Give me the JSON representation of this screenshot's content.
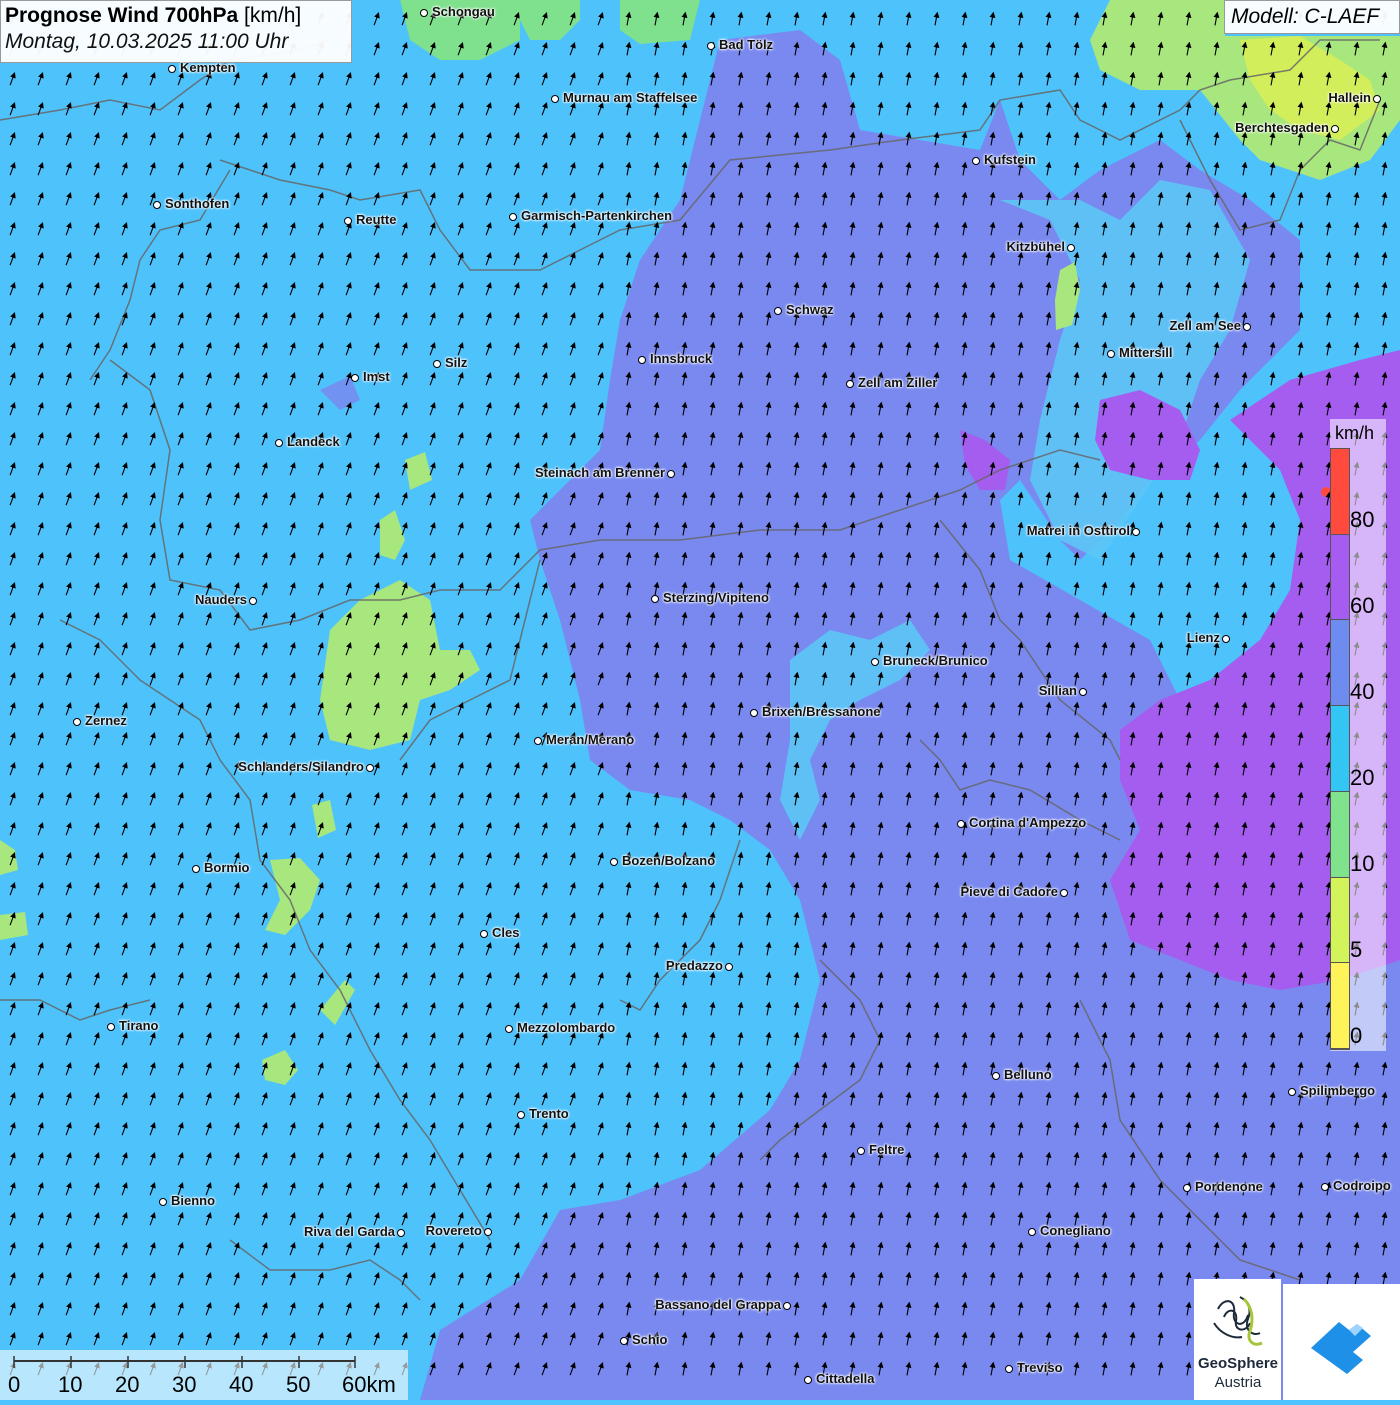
{
  "header": {
    "title_bold": "Prognose Wind 700hPa",
    "title_unit": " [km/h]",
    "datetime": "Montag, 10.03.2025 11:00 Uhr",
    "model": "Modell: C-LAEF"
  },
  "legend": {
    "unit": "km/h",
    "labels": [
      "80",
      "60",
      "40",
      "20",
      "10",
      "5",
      "0"
    ],
    "colors": [
      "#ff4a3d",
      "#a65cf0",
      "#6e8cf0",
      "#33c6f5",
      "#7ee38c",
      "#d2f35a",
      "#fff35a"
    ]
  },
  "scale": {
    "labels": [
      "0",
      "10",
      "20",
      "30",
      "40",
      "50",
      "60km"
    ]
  },
  "branding": {
    "name": "GeoSphere",
    "sub": "Austria"
  },
  "cities": [
    {
      "name": "Schongau"
    },
    {
      "name": "Bad Tölz"
    },
    {
      "name": "Kempten"
    },
    {
      "name": "Murnau am Staffelsee"
    },
    {
      "name": "Hallein"
    },
    {
      "name": "Berchtesgaden"
    },
    {
      "name": "Kufstein"
    },
    {
      "name": "Sonthofen"
    },
    {
      "name": "Reutte"
    },
    {
      "name": "Garmisch-Partenkirchen"
    },
    {
      "name": "Kitzbühel"
    },
    {
      "name": "Schwaz"
    },
    {
      "name": "Zell am See"
    },
    {
      "name": "Mittersill"
    },
    {
      "name": "Innsbruck"
    },
    {
      "name": "Imst"
    },
    {
      "name": "Silz"
    },
    {
      "name": "Zell am Ziller"
    },
    {
      "name": "Landeck"
    },
    {
      "name": "Steinach am Brenner"
    },
    {
      "name": "Matrei in Osttirol"
    },
    {
      "name": "Nauders"
    },
    {
      "name": "Sterzing/Vipiteno"
    },
    {
      "name": "Lienz"
    },
    {
      "name": "Bruneck/Brunico"
    },
    {
      "name": "Sillian"
    },
    {
      "name": "Brixen/Bressanone"
    },
    {
      "name": "Zernez"
    },
    {
      "name": "Meran/Merano"
    },
    {
      "name": "Schlanders/Silandro"
    },
    {
      "name": "Cortina d'Ampezzo"
    },
    {
      "name": "Bozen/Bolzano"
    },
    {
      "name": "Bormio"
    },
    {
      "name": "Pieve di Cadore"
    },
    {
      "name": "Cles"
    },
    {
      "name": "Predazzo"
    },
    {
      "name": "Tirano"
    },
    {
      "name": "Mezzolombardo"
    },
    {
      "name": "Belluno"
    },
    {
      "name": "Spilimbergo"
    },
    {
      "name": "Trento"
    },
    {
      "name": "Feltre"
    },
    {
      "name": "Pordenone"
    },
    {
      "name": "Codroipo"
    },
    {
      "name": "Bienno"
    },
    {
      "name": "Riva del Garda"
    },
    {
      "name": "Rovereto"
    },
    {
      "name": "Conegliano"
    },
    {
      "name": "Bassano del Grappa"
    },
    {
      "name": "Schio"
    },
    {
      "name": "Treviso"
    },
    {
      "name": "Cittadella"
    }
  ]
}
